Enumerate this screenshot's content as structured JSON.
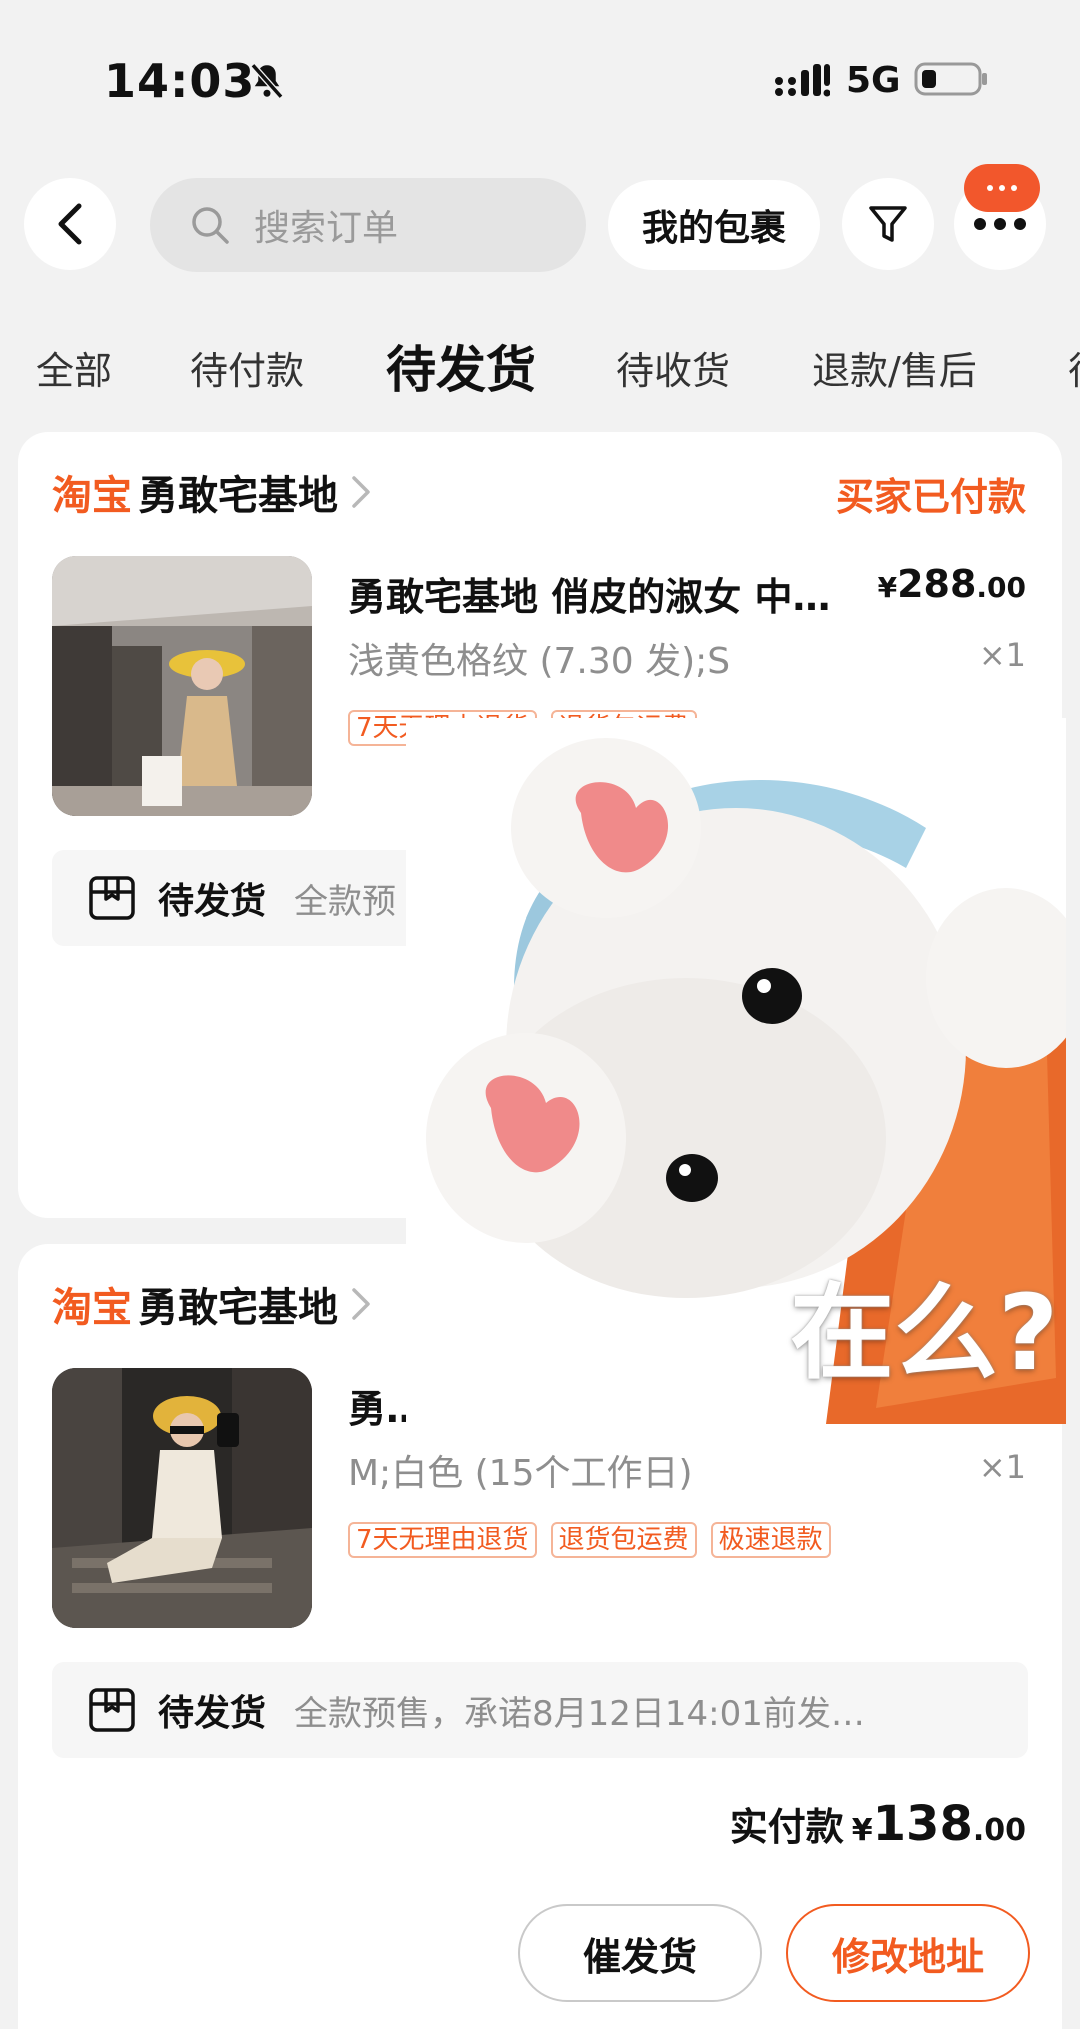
{
  "status_bar": {
    "time": "14:03",
    "network": "5G"
  },
  "top_bar": {
    "search_placeholder": "搜索订单",
    "parcel_label": "我的包裹",
    "message_badge": "···"
  },
  "tabs": [
    {
      "label": "全部",
      "active": false
    },
    {
      "label": "待付款",
      "active": false
    },
    {
      "label": "待发货",
      "active": true
    },
    {
      "label": "待收货",
      "active": false
    },
    {
      "label": "退款/售后",
      "active": false
    },
    {
      "label": "待",
      "active": false
    }
  ],
  "orders": [
    {
      "platform": "淘宝",
      "shop": "勇敢宅基地",
      "status": "买家已付款",
      "item": {
        "title": "勇敢宅基地 俏皮的淑女 中…",
        "currency": "¥",
        "price_int": "288",
        "price_dec": ".00",
        "variant": "浅黄色格纹 (7.30 发);S",
        "quantity": "×1",
        "tags": [
          "7天无理由退货",
          "退货包运费"
        ]
      },
      "shipping": {
        "status": "待发货",
        "note": "全款预"
      }
    },
    {
      "platform": "淘宝",
      "shop": "勇敢宅基地",
      "status": "",
      "item": {
        "title": "勇敢",
        "currency": "¥",
        "price_int": "",
        "price_dec": "",
        "variant": "M;白色 (15个工作日)",
        "quantity": "×1",
        "tags": [
          "7天无理由退货",
          "退货包运费",
          "极速退款"
        ]
      },
      "shipping": {
        "status": "待发货",
        "note": "全款预售，承诺8月12日14:01前发…"
      },
      "paid": {
        "label": "实付款",
        "currency": "¥",
        "int": "138",
        "dec": ".00"
      },
      "actions": {
        "urge": "催发货",
        "address": "修改地址"
      }
    }
  ],
  "sticker": {
    "text": "在么?"
  },
  "colors": {
    "accent": "#f25b20",
    "background": "#f2f2f2"
  }
}
